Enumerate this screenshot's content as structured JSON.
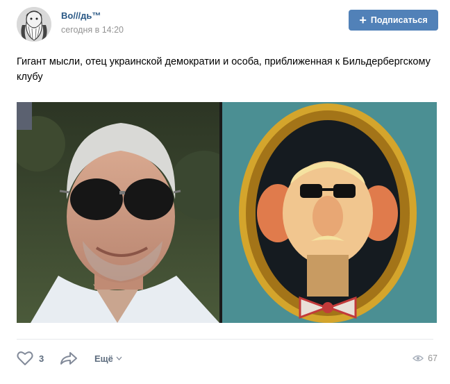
{
  "header": {
    "author_name": "Во///дь™",
    "post_time": "сегодня в 14:20",
    "subscribe_label": "Подписаться",
    "avatar_icon": "bearded-man-avatar-icon"
  },
  "post": {
    "text": "Гигант мысли, отец украинской демократии и особа, приближенная к Бильдербергскому клубу"
  },
  "media": {
    "left_photo": "photo-man-sunglasses",
    "right_photo": "cartoon-portrait-in-gold-frame"
  },
  "footer": {
    "like_count": "3",
    "more_label": "Ещё",
    "views_count": "67"
  },
  "colors": {
    "accent": "#5181b8",
    "link": "#2a5885",
    "muted": "#939393",
    "action": "#5d6c7e"
  }
}
